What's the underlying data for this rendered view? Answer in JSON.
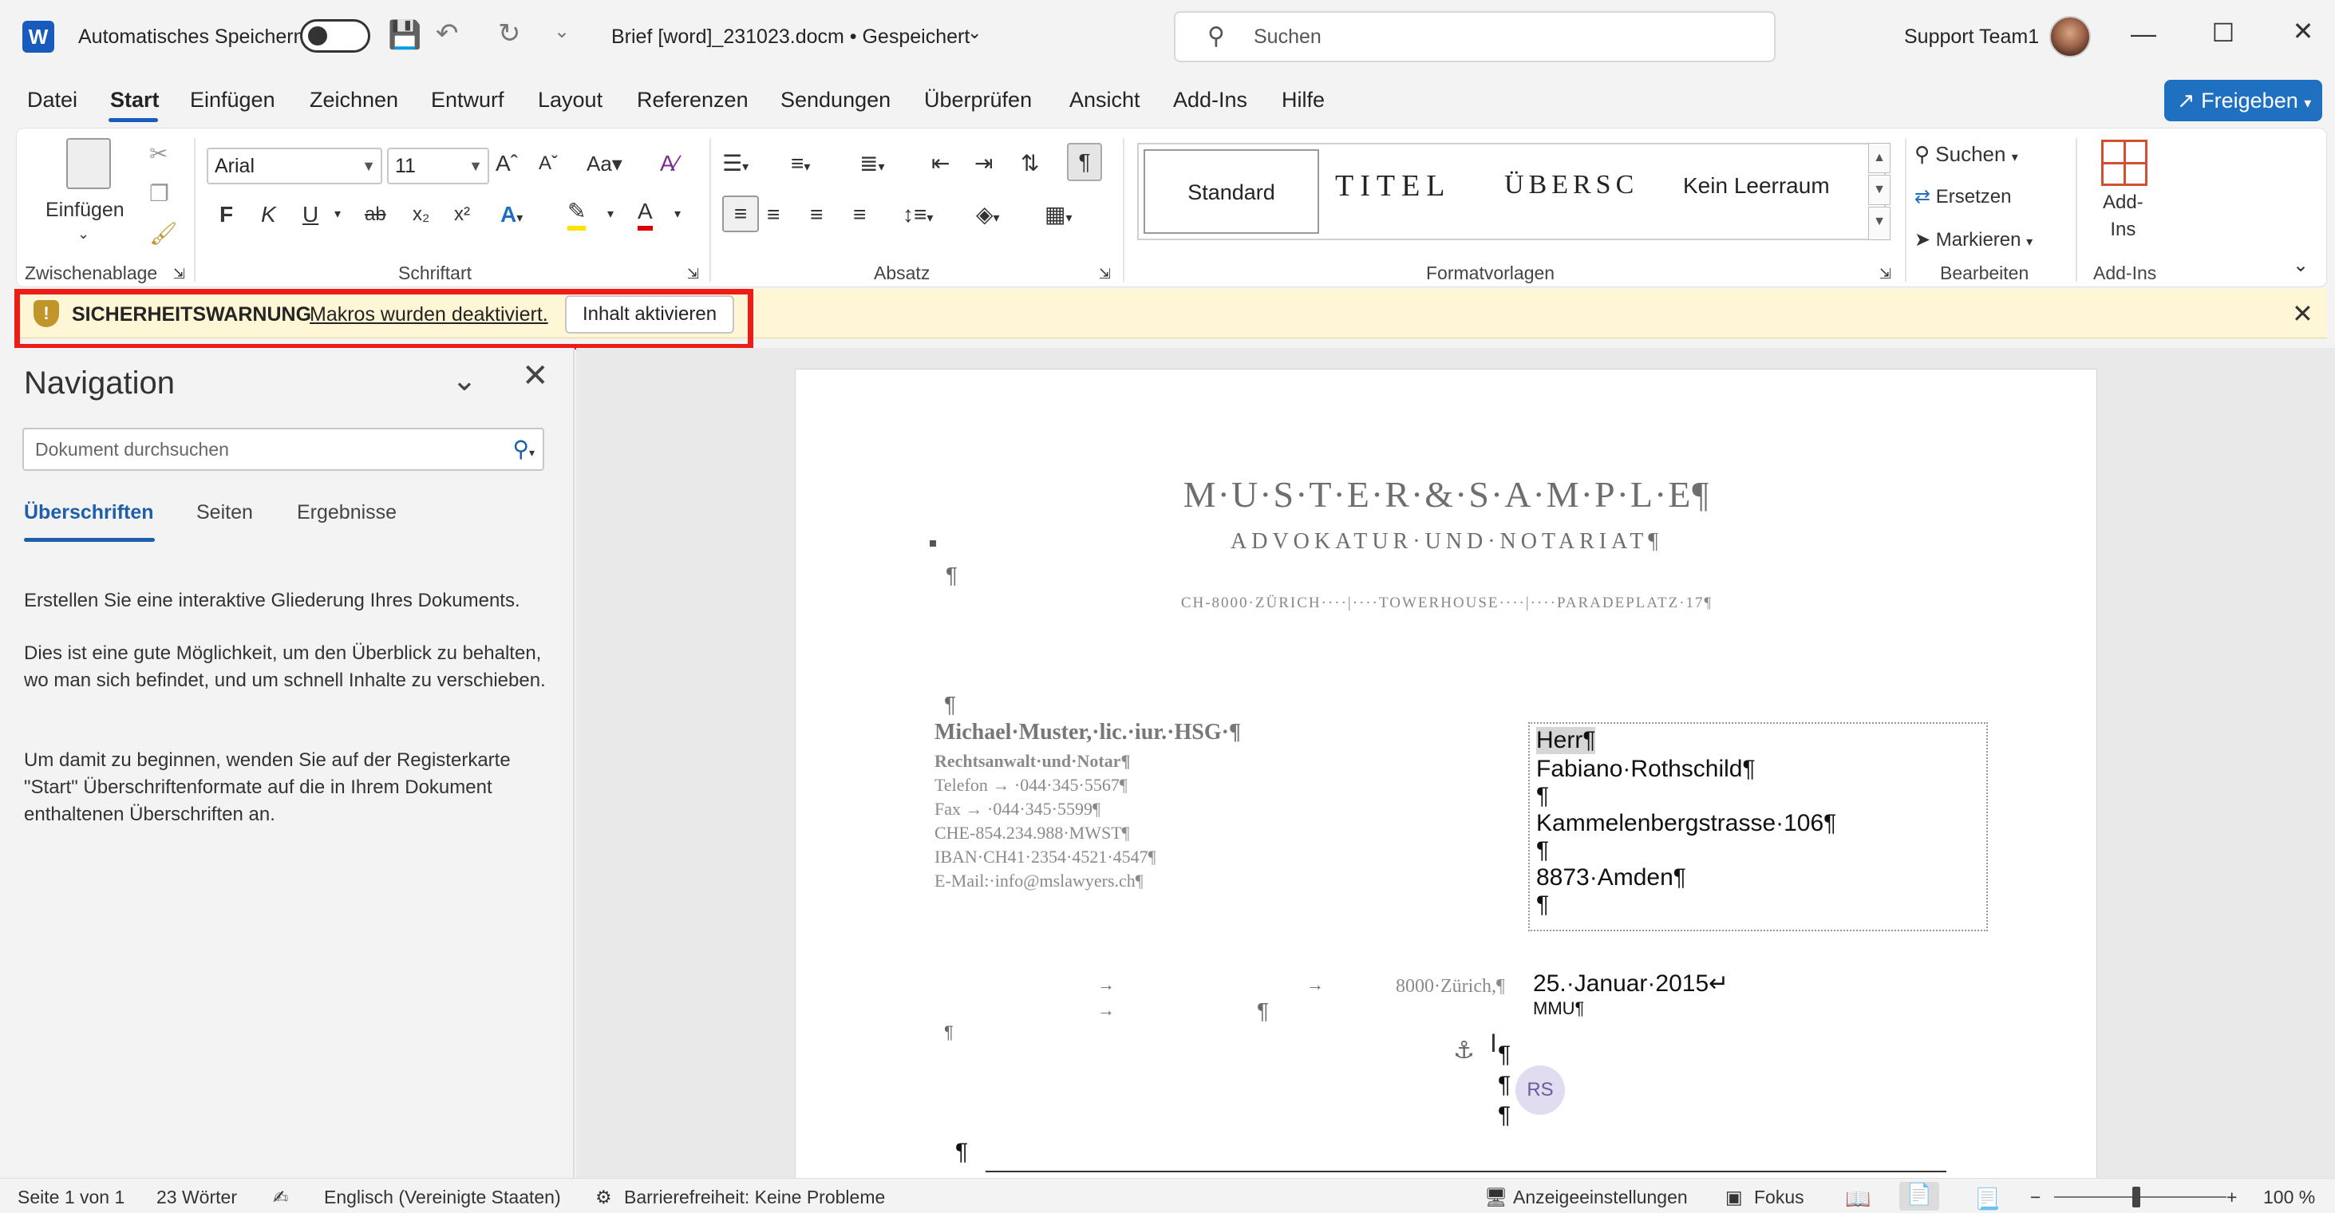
{
  "titlebar": {
    "autosave_label": "Automatisches Speichern",
    "doc_title": "Brief [word]_231023.docm • Gespeichert",
    "search_placeholder": "Suchen",
    "user_name": "Support Team1"
  },
  "tabs": [
    "Datei",
    "Start",
    "Einfügen",
    "Zeichnen",
    "Entwurf",
    "Layout",
    "Referenzen",
    "Sendungen",
    "Überprüfen",
    "Ansicht",
    "Add-Ins",
    "Hilfe"
  ],
  "active_tab": "Start",
  "share_label": "Freigeben",
  "ribbon": {
    "clipboard": {
      "paste_label": "Einfügen",
      "group_label": "Zwischenablage"
    },
    "font": {
      "font_name": "Arial",
      "font_size": "11",
      "group_label": "Schriftart",
      "bold": "F",
      "italic": "K",
      "underline": "U"
    },
    "paragraph": {
      "group_label": "Absatz"
    },
    "styles": {
      "items": [
        "Standard",
        "TITEL",
        "ÜBERSC",
        "Kein Leerraum"
      ],
      "group_label": "Formatvorlagen"
    },
    "editing": {
      "search": "Suchen",
      "replace": "Ersetzen",
      "select": "Markieren",
      "group_label": "Bearbeiten"
    },
    "addins": {
      "label_line1": "Add-",
      "label_line2": "Ins",
      "group_label": "Add-Ins"
    }
  },
  "security_bar": {
    "title": "SICHERHEITSWARNUNG",
    "message": "Makros wurden deaktiviert.",
    "button": "Inhalt aktivieren"
  },
  "navigation": {
    "title": "Navigation",
    "search_placeholder": "Dokument durchsuchen",
    "tabs": [
      "Überschriften",
      "Seiten",
      "Ergebnisse"
    ],
    "para1": "Erstellen Sie eine interaktive Gliederung Ihres Dokuments.",
    "para2": "Dies ist eine gute Möglichkeit, um den Überblick zu behalten, wo man sich befindet, und um schnell Inhalte zu verschieben.",
    "para3": "Um damit zu beginnen, wenden Sie auf der Registerkarte \"Start\" Überschriftenformate auf die in Ihrem Dokument enthaltenen Überschriften an."
  },
  "document": {
    "firm_name": "M·U·S·T·E·R·&·S·A·M·P·L·E¶",
    "firm_sub": "ADVOKATUR·UND·NOTARIAT¶",
    "firm_addr": "CH-8000·ZÜRICH····|····TOWERHOUSE····|····PARADEPLATZ·17¶",
    "sender_name": "Michael·Muster,·lic.·iur.·HSG·¶",
    "sender_lines": [
      "Rechtsanwalt·und·Notar¶",
      "Telefon  →  ·044·345·5567¶",
      "Fax  →  ·044·345·5599¶",
      "CHE-854.234.988·MWST¶",
      "IBAN·CH41·2354·4521·4547¶",
      "E-Mail:·info@mslawyers.ch¶"
    ],
    "recipient": [
      "Herr¶",
      "Fabiano·Rothschild¶",
      "¶",
      "Kammelenbergstrasse·106¶",
      "¶",
      "8873·Amden¶",
      "¶"
    ],
    "place": "8000·Zürich,¶",
    "date": "25.·Januar·2015↵",
    "initials": "MMU¶",
    "pilcrow": "¶",
    "arrow": "→",
    "comment_badge": "RS"
  },
  "statusbar": {
    "page": "Seite 1 von 1",
    "words": "23 Wörter",
    "language": "Englisch (Vereinigte Staaten)",
    "accessibility": "Barrierefreiheit: Keine Probleme",
    "display_settings": "Anzeigeeinstellungen",
    "focus": "Fokus",
    "zoom": "100 %"
  }
}
